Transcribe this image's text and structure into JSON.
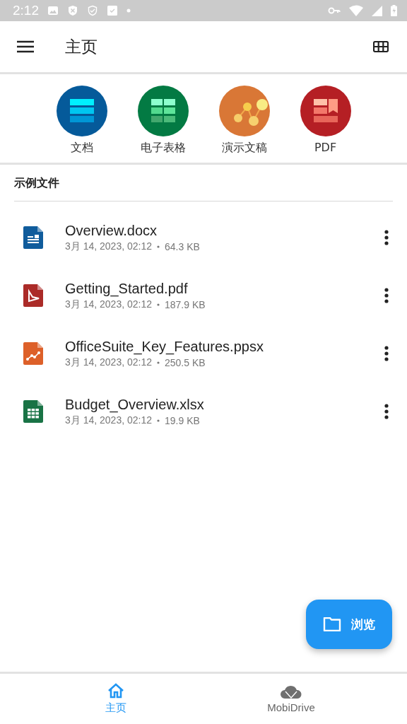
{
  "status_bar": {
    "time": "2:12"
  },
  "app_bar": {
    "title": "主页"
  },
  "categories": [
    {
      "kind": "doc",
      "label": "文档"
    },
    {
      "kind": "sheet",
      "label": "电子表格"
    },
    {
      "kind": "slides",
      "label": "演示文稿"
    },
    {
      "kind": "pdf",
      "label": "PDF"
    }
  ],
  "section": {
    "title": "示例文件"
  },
  "files": [
    {
      "kind": "doc",
      "name": "Overview.docx",
      "date": "3月 14, 2023, 02:12",
      "size": "64.3 KB"
    },
    {
      "kind": "pdf",
      "name": "Getting_Started.pdf",
      "date": "3月 14, 2023, 02:12",
      "size": "187.9 KB"
    },
    {
      "kind": "slides",
      "name": "OfficeSuite_Key_Features.ppsx",
      "date": "3月 14, 2023, 02:12",
      "size": "250.5 KB"
    },
    {
      "kind": "sheet",
      "name": "Budget_Overview.xlsx",
      "date": "3月 14, 2023, 02:12",
      "size": "19.9 KB"
    }
  ],
  "fab": {
    "label": "浏览"
  },
  "bottom_nav": [
    {
      "kind": "home",
      "label": "主页",
      "selected": true
    },
    {
      "kind": "cloud",
      "label": "MobiDrive",
      "selected": false
    }
  ]
}
